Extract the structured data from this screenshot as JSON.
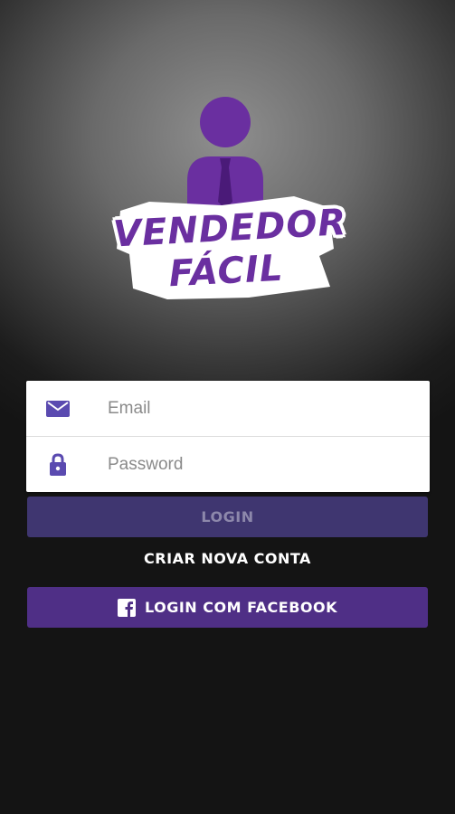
{
  "logo": {
    "line1": "VENDEDOR",
    "line2": "FÁCIL",
    "color": "#6a2fa0"
  },
  "form": {
    "email": {
      "placeholder": "Email",
      "value": "",
      "icon": "envelope-icon"
    },
    "password": {
      "placeholder": "Password",
      "value": "",
      "icon": "lock-icon"
    }
  },
  "buttons": {
    "login_label": "LOGIN",
    "create_account_label": "CRIAR NOVA CONTA",
    "facebook_label": "LOGIN COM FACEBOOK"
  },
  "colors": {
    "accent": "#4f2f86",
    "login_button": "#3f3670",
    "icon": "#5a4ab0"
  }
}
